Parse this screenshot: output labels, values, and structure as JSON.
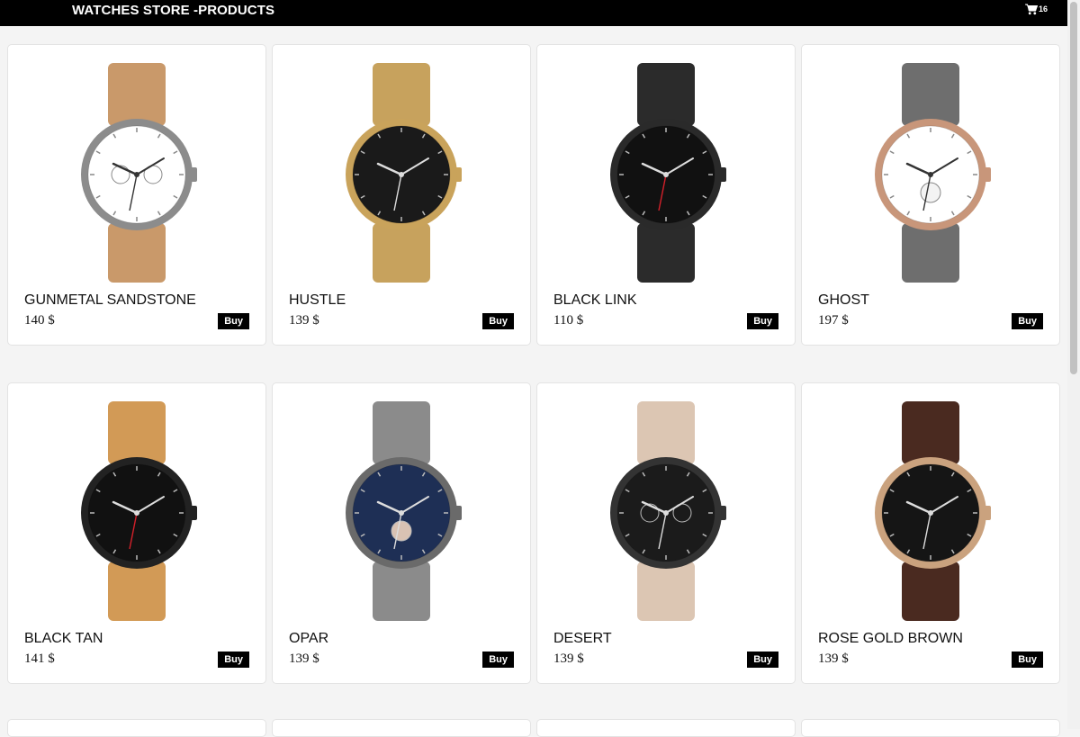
{
  "header": {
    "title": "WATCHES STORE -PRODUCTS",
    "cart_count": "16"
  },
  "products": [
    {
      "name": "GUNMETAL SANDSTONE",
      "price": "140 $",
      "buy_label": "Buy",
      "strap": "#c9996a",
      "case": "#8c8c8c",
      "dial": "#ffffff",
      "kind": "chrono"
    },
    {
      "name": "HUSTLE",
      "price": "139 $",
      "buy_label": "Buy",
      "strap": "#c7a25d",
      "case": "#c9a35b",
      "dial": "#1a1a1a",
      "kind": "plain"
    },
    {
      "name": "BLACK LINK",
      "price": "110 $",
      "buy_label": "Buy",
      "strap": "#2b2b2b",
      "case": "#2a2a2a",
      "dial": "#111111",
      "kind": "red"
    },
    {
      "name": "GHOST",
      "price": "197 $",
      "buy_label": "Buy",
      "strap": "#6e6e6e",
      "case": "#c8967a",
      "dial": "#ffffff",
      "kind": "sub"
    },
    {
      "name": "BLACK TAN",
      "price": "141 $",
      "buy_label": "Buy",
      "strap": "#d29a56",
      "case": "#222222",
      "dial": "#111111",
      "kind": "red"
    },
    {
      "name": "OPAR",
      "price": "139 $",
      "buy_label": "Buy",
      "strap": "#8b8b8b",
      "case": "#6a6a6a",
      "dial": "#1e2f55",
      "kind": "sub"
    },
    {
      "name": "DESERT",
      "price": "139 $",
      "buy_label": "Buy",
      "strap": "#dcc6b3",
      "case": "#333333",
      "dial": "#1b1b1b",
      "kind": "chrono"
    },
    {
      "name": "ROSE GOLD BROWN",
      "price": "139 $",
      "buy_label": "Buy",
      "strap": "#4a2a20",
      "case": "#caa27e",
      "dial": "#151515",
      "kind": "plain"
    }
  ]
}
